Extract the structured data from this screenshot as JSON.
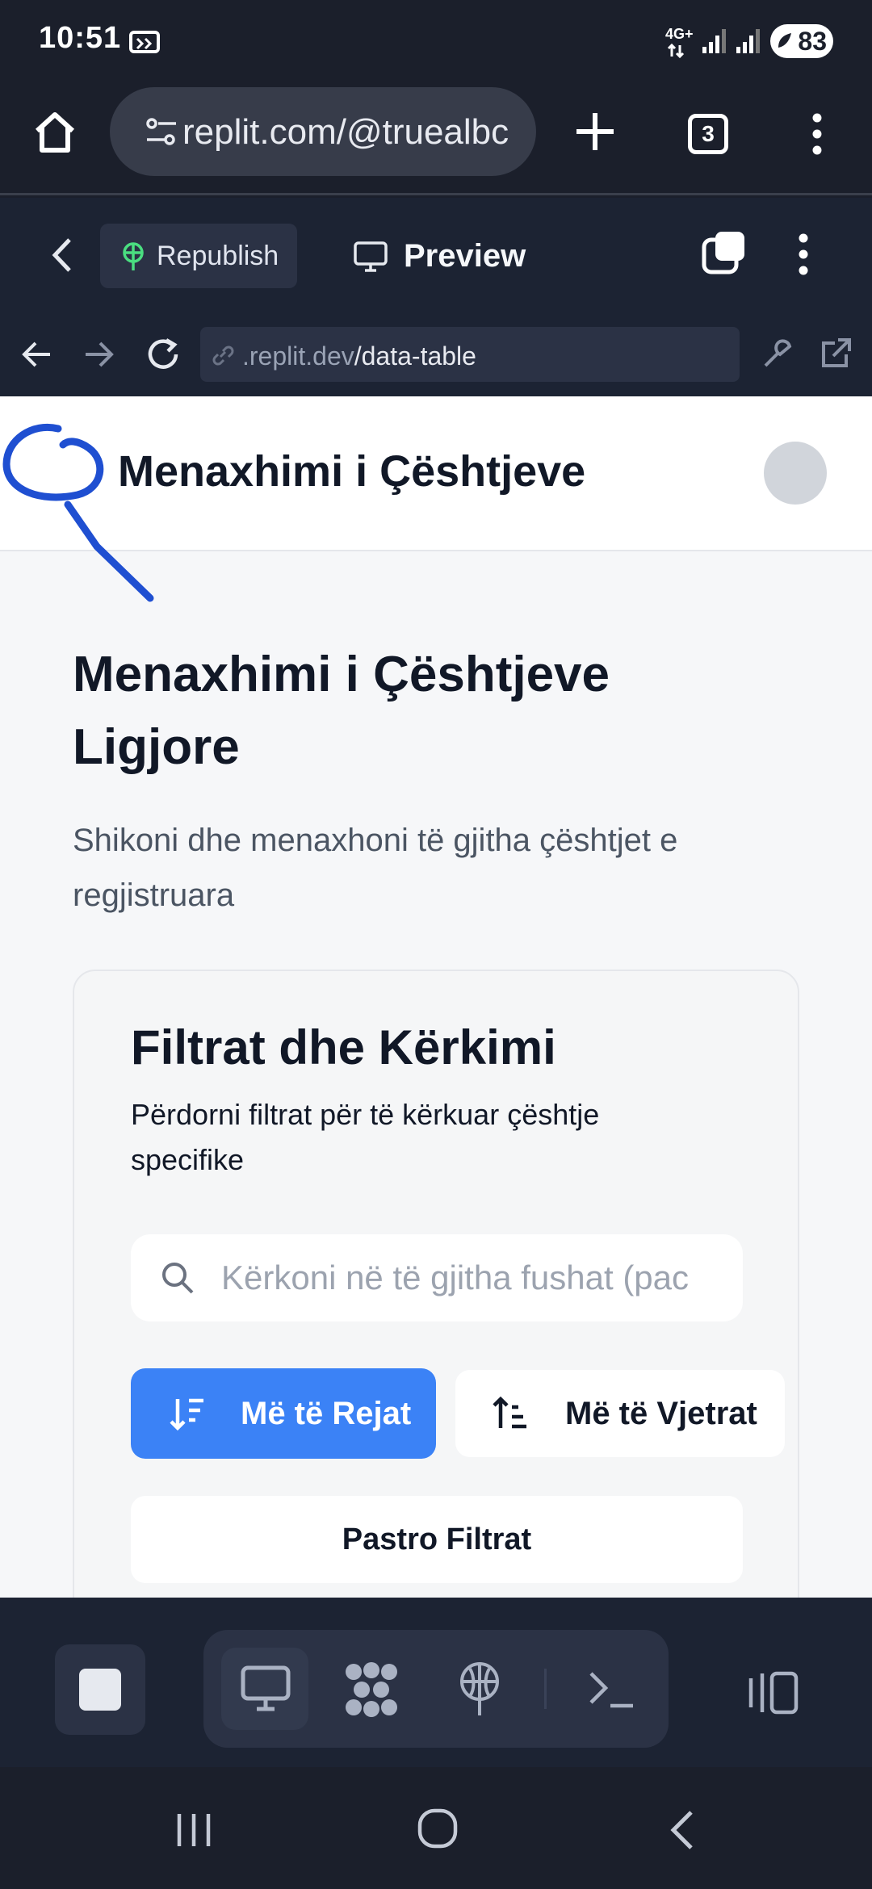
{
  "status_bar": {
    "time": "10:51",
    "network": "4G+",
    "battery": "83"
  },
  "browser": {
    "url": "replit.com/@truealbc",
    "tab_count": "3",
    "icons": [
      "home-icon",
      "site-settings-icon",
      "new-tab-icon",
      "tabs-icon",
      "more-icon"
    ]
  },
  "replit_header": {
    "republish_label": "Republish",
    "preview_label": "Preview"
  },
  "webview_nav": {
    "address_domain": ".replit.dev",
    "address_path": "/data-table"
  },
  "app": {
    "header_title": "Menaxhimi i Çështjeve",
    "page_title": "Menaxhimi i Çështjeve Ligjore",
    "page_subtitle": "Shikoni dhe menaxhoni të gjitha çështjet e regjistruara",
    "filters": {
      "title": "Filtrat dhe Kërkimi",
      "description": "Përdorni filtrat për të kërkuar çështje specifike",
      "search_placeholder": "Kërkoni në të gjitha fushat (pac",
      "sort_newest_label": "Më të Rejat",
      "sort_oldest_label": "Më të Vjetrat",
      "clear_label": "Pastro Filtrat"
    }
  },
  "colors": {
    "primary_button": "#3b82f6",
    "replit_bg": "#1c2333",
    "annotation_stroke": "#1f4fd1"
  }
}
